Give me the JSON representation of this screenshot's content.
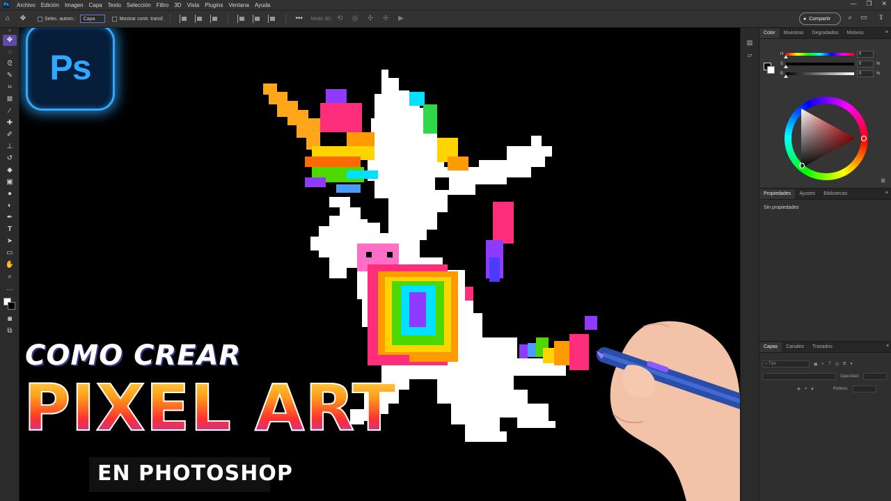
{
  "menubar": {
    "items": [
      "Archivo",
      "Edición",
      "Imagen",
      "Capa",
      "Texto",
      "Selección",
      "Filtro",
      "3D",
      "Vista",
      "Plugins",
      "Ventana",
      "Ayuda"
    ],
    "window_controls": [
      "—",
      "❐",
      "✕"
    ]
  },
  "options_bar": {
    "auto_select_label": "Selec. autom.:",
    "target_value": "Capa",
    "show_transform_label": "Mostrar contr. transf.",
    "mode3d_label": "Modo 3D:",
    "share_label": "Compartir"
  },
  "thumbnail_text": {
    "line1": "COMO CREAR",
    "line2": "PIXEL ART",
    "line3": "EN PHOTOSHOP",
    "logo": "Ps"
  },
  "color_panel": {
    "tabs": [
      "Color",
      "Muestras",
      "Degradados",
      "Motivos"
    ],
    "sliders": [
      {
        "label": "H",
        "value": "0",
        "unit": ""
      },
      {
        "label": "S",
        "value": "0",
        "unit": "%"
      },
      {
        "label": "B",
        "value": "0",
        "unit": "%"
      }
    ],
    "hue_colors": [
      "#ff0000",
      "#ffff00",
      "#00ff00",
      "#00ffff",
      "#0000ff",
      "#ff00ff",
      "#ff0000"
    ]
  },
  "properties_panel": {
    "tabs": [
      "Propiedades",
      "Ajustes",
      "Bibliotecas"
    ],
    "empty_text": "Sin propiedades"
  },
  "layers_panel": {
    "tabs": [
      "Capas",
      "Canales",
      "Trazados"
    ],
    "filter_placeholder": "Tipo",
    "opacity_label": "Opacidad:",
    "fill_label": "Relleno:"
  },
  "accent_colors": {
    "ps_blue": "#31a8ff",
    "active_tool": "#5d4aa9"
  }
}
